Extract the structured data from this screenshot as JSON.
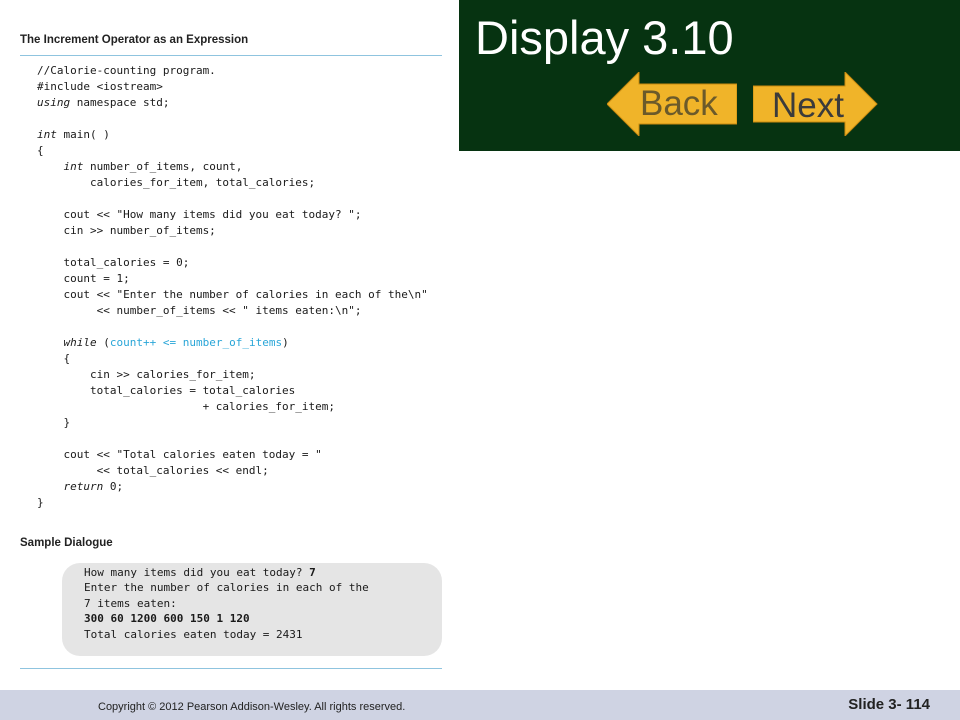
{
  "slide": {
    "title": "Display 3.10",
    "back_label": "Back",
    "next_label": "Next",
    "footer_copyright": "Copyright © 2012 Pearson Addison-Wesley.  All rights reserved.",
    "slide_number": "Slide 3- 114"
  },
  "listing": {
    "heading": "The Increment Operator as an Expression",
    "code_lines": [
      "//Calorie-counting program.",
      "#include <iostream>",
      "using namespace std;",
      "",
      "int main( )",
      "{",
      "    int number_of_items, count,",
      "        calories_for_item, total_calories;",
      "",
      "    cout << \"How many items did you eat today? \";",
      "    cin >> number_of_items;",
      "",
      "    total_calories = 0;",
      "    count = 1;",
      "    cout << \"Enter the number of calories in each of the\\n\"",
      "         << number_of_items << \" items eaten:\\n\";",
      "",
      "    while (count++ <= number_of_items)",
      "    {",
      "        cin >> calories_for_item;",
      "        total_calories = total_calories",
      "                         + calories_for_item;",
      "    }",
      "",
      "    cout << \"Total calories eaten today = \"",
      "         << total_calories << endl;",
      "    return 0;",
      "}"
    ],
    "dialog_heading": "Sample Dialogue",
    "dialog_lines": [
      {
        "text": "How many items did you eat today? ",
        "input": "7"
      },
      {
        "text": "Enter the number of calories in each of the",
        "input": ""
      },
      {
        "text": "7 items eaten:",
        "input": ""
      },
      {
        "text": "",
        "input": "300 60 1200 600 150 1 120"
      },
      {
        "text": "Total calories eaten today = 2431",
        "input": ""
      }
    ]
  },
  "colors": {
    "title_panel": "#063311",
    "button_gold": "#f0b429",
    "highlight": "#2aa6d8",
    "footer": "#cfd3e3"
  }
}
